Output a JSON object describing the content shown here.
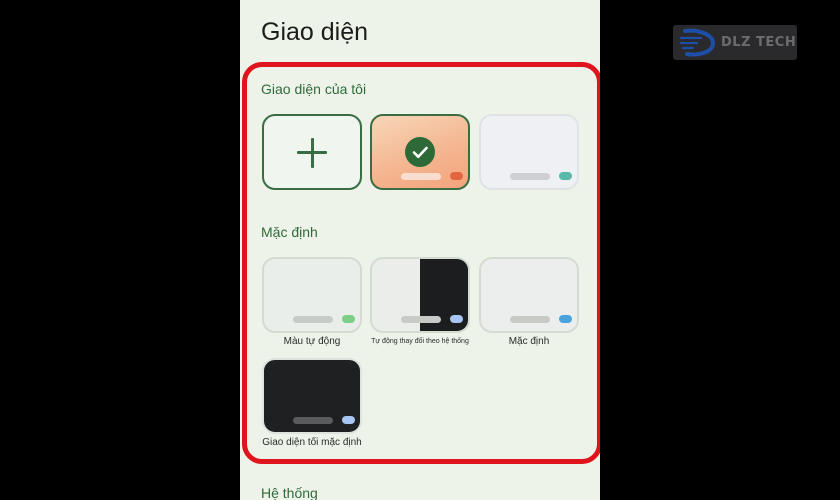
{
  "screen": {
    "title": "Giao diện",
    "my_themes_label": "Giao diện của tôi",
    "default_label": "Mặc định",
    "system_label": "Hệ thống"
  },
  "my_themes": [
    {
      "kind": "add",
      "icon": "plus-icon"
    },
    {
      "kind": "selected",
      "icon": "check-icon",
      "accent": "#e4643f"
    },
    {
      "kind": "light",
      "accent": "#5bb8ad"
    }
  ],
  "default_themes": [
    {
      "caption": "Màu tự động",
      "accent": "#7ecf86"
    },
    {
      "caption": "Tự động thay đổi theo hệ thống",
      "accent": "#a7c5f3"
    },
    {
      "caption": "Mặc định",
      "accent": "#4aa3de"
    },
    {
      "caption": "Giao diện tối mặc định",
      "accent": "#a7c5f3"
    }
  ],
  "logo": {
    "text": "DLZ TECH",
    "colors": {
      "primary": "#1e4fa8",
      "text": "#6b6b70"
    }
  },
  "colors": {
    "highlight": "#e0141c",
    "accent_green": "#2f6b3a",
    "background": "#eef3ea"
  }
}
